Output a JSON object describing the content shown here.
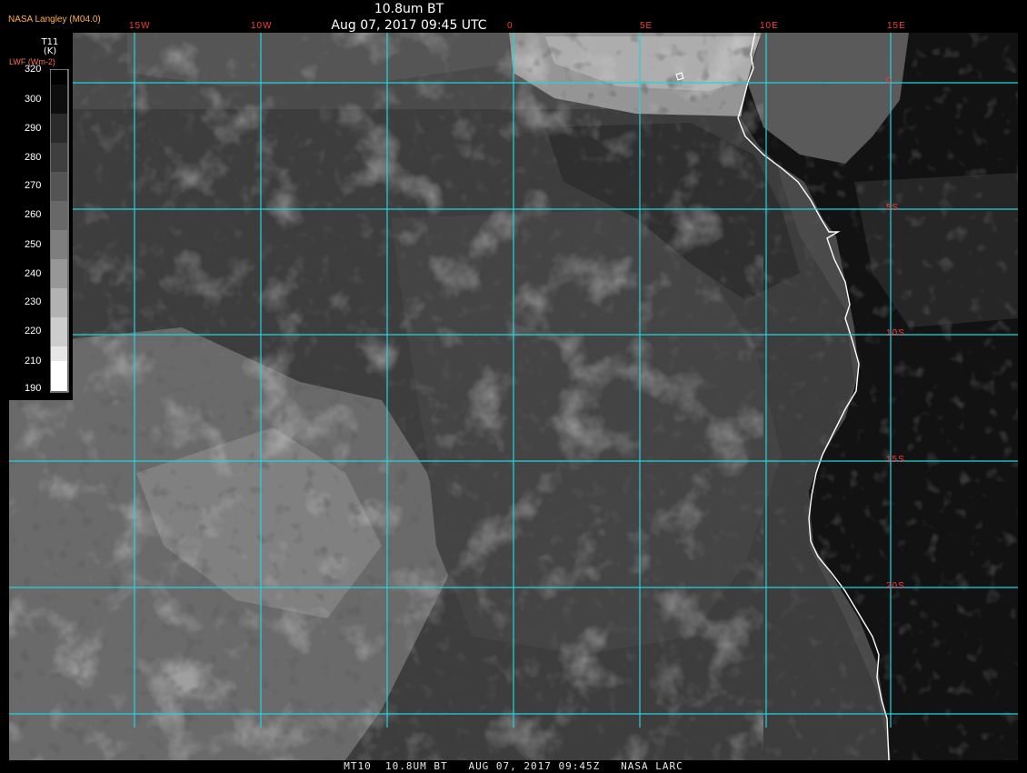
{
  "header": {
    "title": "10.8um BT",
    "subtitle": "Aug 07, 2017 09:45 UTC",
    "credit": "NASA Langley (M04.0)"
  },
  "footer": "MT10  10.8UM BT   AUG 07, 2017 09:45Z   NASA LARC",
  "colorbar": {
    "title_line1": "T11",
    "title_line2": "(K)",
    "subtitle": "LWF (Wm-2)",
    "labels": [
      "320",
      "300",
      "290",
      "280",
      "270",
      "260",
      "250",
      "240",
      "230",
      "220",
      "210",
      "190"
    ]
  },
  "grid": {
    "lon_labels": [
      "15W",
      "10W",
      "0",
      "5E",
      "10E",
      "15E"
    ],
    "lat_labels": [
      "0",
      "5S",
      "10S",
      "15S",
      "20S"
    ],
    "line_color": "#22d4e0",
    "label_color": "#ff3a3a",
    "coastline_color": "#ffffff"
  }
}
